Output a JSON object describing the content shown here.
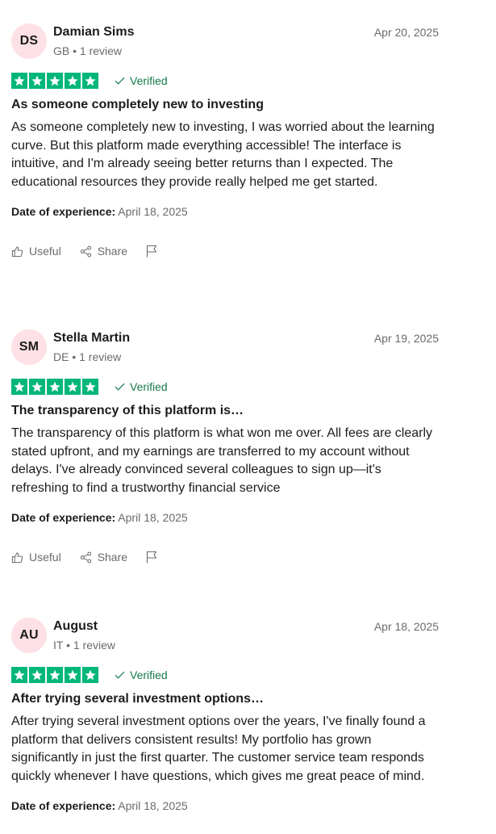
{
  "colors": {
    "star_green": "#00b67a",
    "verified_green": "#157a4b",
    "avatar_bg": "#fde1e6"
  },
  "labels": {
    "verified": "Verified",
    "date_of_experience": "Date of experience:",
    "useful": "Useful",
    "share": "Share"
  },
  "reviews": [
    {
      "initials": "DS",
      "name": "Damian Sims",
      "meta": "GB • 1 review",
      "date": "Apr 20, 2025",
      "rating": 5,
      "title": "As someone completely new to investing",
      "body": "As someone completely new to investing, I was worried about the learning curve. But this platform made everything accessible! The interface is intuitive, and I'm already seeing better returns than I expected. The educational resources they provide really helped me get started.",
      "experience_date": "April 18, 2025"
    },
    {
      "initials": "SM",
      "name": "Stella Martin",
      "meta": "DE • 1 review",
      "date": "Apr 19, 2025",
      "rating": 5,
      "title": "The transparency of this platform is…",
      "body": "The transparency of this platform is what won me over. All fees are clearly stated upfront, and my earnings are transferred to my account without delays. I've already convinced several colleagues to sign up—it's refreshing to find a trustworthy financial service",
      "experience_date": "April 18, 2025"
    },
    {
      "initials": "AU",
      "name": "August",
      "meta": "IT • 1 review",
      "date": "Apr 18, 2025",
      "rating": 5,
      "title": "After trying several investment options…",
      "body": "After trying several investment options over the years, I've finally found a platform that delivers consistent results! My portfolio has grown significantly in just the first quarter. The customer service team responds quickly whenever I have questions, which gives me great peace of mind.",
      "experience_date": "April 18, 2025"
    }
  ]
}
